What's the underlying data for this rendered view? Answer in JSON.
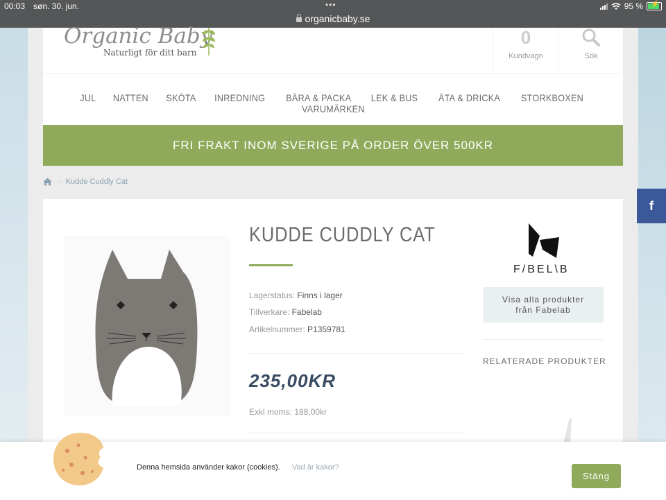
{
  "status_bar": {
    "time": "00:03",
    "date": "søn. 30. jun.",
    "url": "organicbaby.se",
    "battery": "95 %"
  },
  "header": {
    "logo_text": "Organic Baby",
    "logo_tagline": "Naturligt för ditt barn",
    "cart_count": "0",
    "cart_label": "Kundvagn",
    "search_label": "Sök"
  },
  "nav": {
    "items": [
      "JUL",
      "NATTEN",
      "SKÖTA",
      "INREDNING",
      "BÄRA & PACKA",
      "LEK & BUS",
      "ÄTA & DRICKA",
      "STORKBOXEN",
      "VARUMÄRKEN"
    ]
  },
  "promo": {
    "text": "FRI FRAKT INOM SVERIGE PÅ ORDER ÖVER 500KR"
  },
  "breadcrumb": {
    "separator": "-",
    "current": "Kudde Cuddly Cat"
  },
  "product": {
    "title": "KUDDE CUDDLY CAT",
    "stock_label": "Lagerstatus:",
    "stock_value": "Finns i lager",
    "maker_label": "Tillverkare:",
    "maker_value": "Fabelab",
    "sku_label": "Artikelnummer:",
    "sku_value": "P1359781",
    "price": "235,00KR",
    "ex_vat": "Exkl moms: 188,00kr"
  },
  "brand": {
    "name": "F/BEL\\B",
    "button_line1": "Visa alla produkter",
    "button_line2": "från Fabelab"
  },
  "related": {
    "title": "RELATERADE PRODUKTER"
  },
  "social": {
    "facebook_glyph": "f"
  },
  "cookie": {
    "text": "Denna hemsida använder kakor (cookies).",
    "link": "Vad är kakor?",
    "button": "Stäng"
  },
  "colors": {
    "accent_green": "#8eaa5a",
    "price_navy": "#374a62",
    "facebook_blue": "#3b5998"
  }
}
